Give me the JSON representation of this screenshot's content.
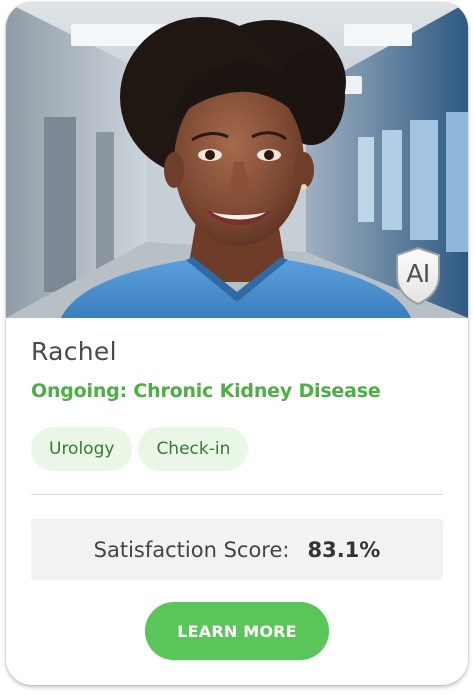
{
  "card": {
    "name": "Rachel",
    "condition": "Ongoing: Chronic Kidney Disease",
    "tags": [
      "Urology",
      "Check-in"
    ],
    "ai_badge": "AI",
    "satisfaction": {
      "label": "Satisfaction Score:",
      "value": "83.1%"
    },
    "cta_label": "LEARN MORE"
  },
  "colors": {
    "accent_green": "#4caf45",
    "button_green": "#5ac65a",
    "tag_bg": "#eaf6e6",
    "scrub_blue": "#4a8fcf"
  },
  "photo": {
    "subject": "smiling nurse in blue scrubs in a hospital corridor"
  }
}
